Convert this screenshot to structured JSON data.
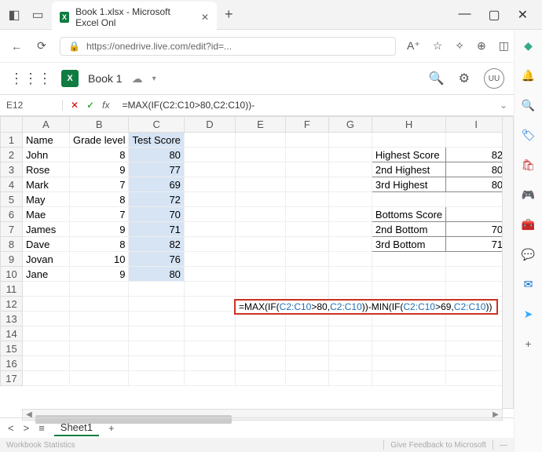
{
  "window": {
    "tab_title": "Book 1.xlsx - Microsoft Excel Onl",
    "url": "https://onedrive.live.com/edit?id=..."
  },
  "app": {
    "workbook_name": "Book 1",
    "user_initials": "UU"
  },
  "formula_bar": {
    "cell_ref": "E12",
    "formula": "=MAX(IF(C2:C10>80,C2:C10))-"
  },
  "columns": [
    "A",
    "B",
    "C",
    "D",
    "E",
    "F",
    "G",
    "H",
    "I"
  ],
  "row_labels": [
    "1",
    "2",
    "3",
    "4",
    "5",
    "6",
    "7",
    "8",
    "9",
    "10",
    "11",
    "12",
    "13",
    "14",
    "15",
    "16",
    "17"
  ],
  "data": {
    "headers": {
      "A": "Name",
      "B": "Grade level",
      "C": "Test Score"
    },
    "rows": [
      {
        "name": "John",
        "grade": "8",
        "score": "80"
      },
      {
        "name": "Rose",
        "grade": "9",
        "score": "77"
      },
      {
        "name": "Mark",
        "grade": "7",
        "score": "69"
      },
      {
        "name": "May",
        "grade": "8",
        "score": "72"
      },
      {
        "name": "Mae",
        "grade": "7",
        "score": "70"
      },
      {
        "name": "James",
        "grade": "9",
        "score": "71"
      },
      {
        "name": "Dave",
        "grade": "8",
        "score": "82"
      },
      {
        "name": "Jovan",
        "grade": "10",
        "score": "76"
      },
      {
        "name": "Jane",
        "grade": "9",
        "score": "80"
      }
    ],
    "summary_top": [
      {
        "label": "Highest Score",
        "value": "82"
      },
      {
        "label": "2nd Highest",
        "value": "80"
      },
      {
        "label": "3rd Highest",
        "value": "80"
      }
    ],
    "summary_bottom_header": "Bottoms Score",
    "summary_bottom": [
      {
        "label": "2nd Bottom",
        "value": "70"
      },
      {
        "label": "3rd Bottom",
        "value": "71"
      }
    ]
  },
  "formula_overlay": {
    "prefix": "=MAX(IF(",
    "ref1": "C2:C10",
    "mid1": ">80,",
    "ref2": "C2:C10",
    "mid2": "))-MIN(IF(",
    "ref3": "C2:C10",
    "mid3": ">69,",
    "ref4": "C2:C10",
    "suffix": "))"
  },
  "sheet_tab": "Sheet1",
  "status": {
    "left": "Workbook Statistics",
    "right": "Give Feedback to Microsoft"
  }
}
